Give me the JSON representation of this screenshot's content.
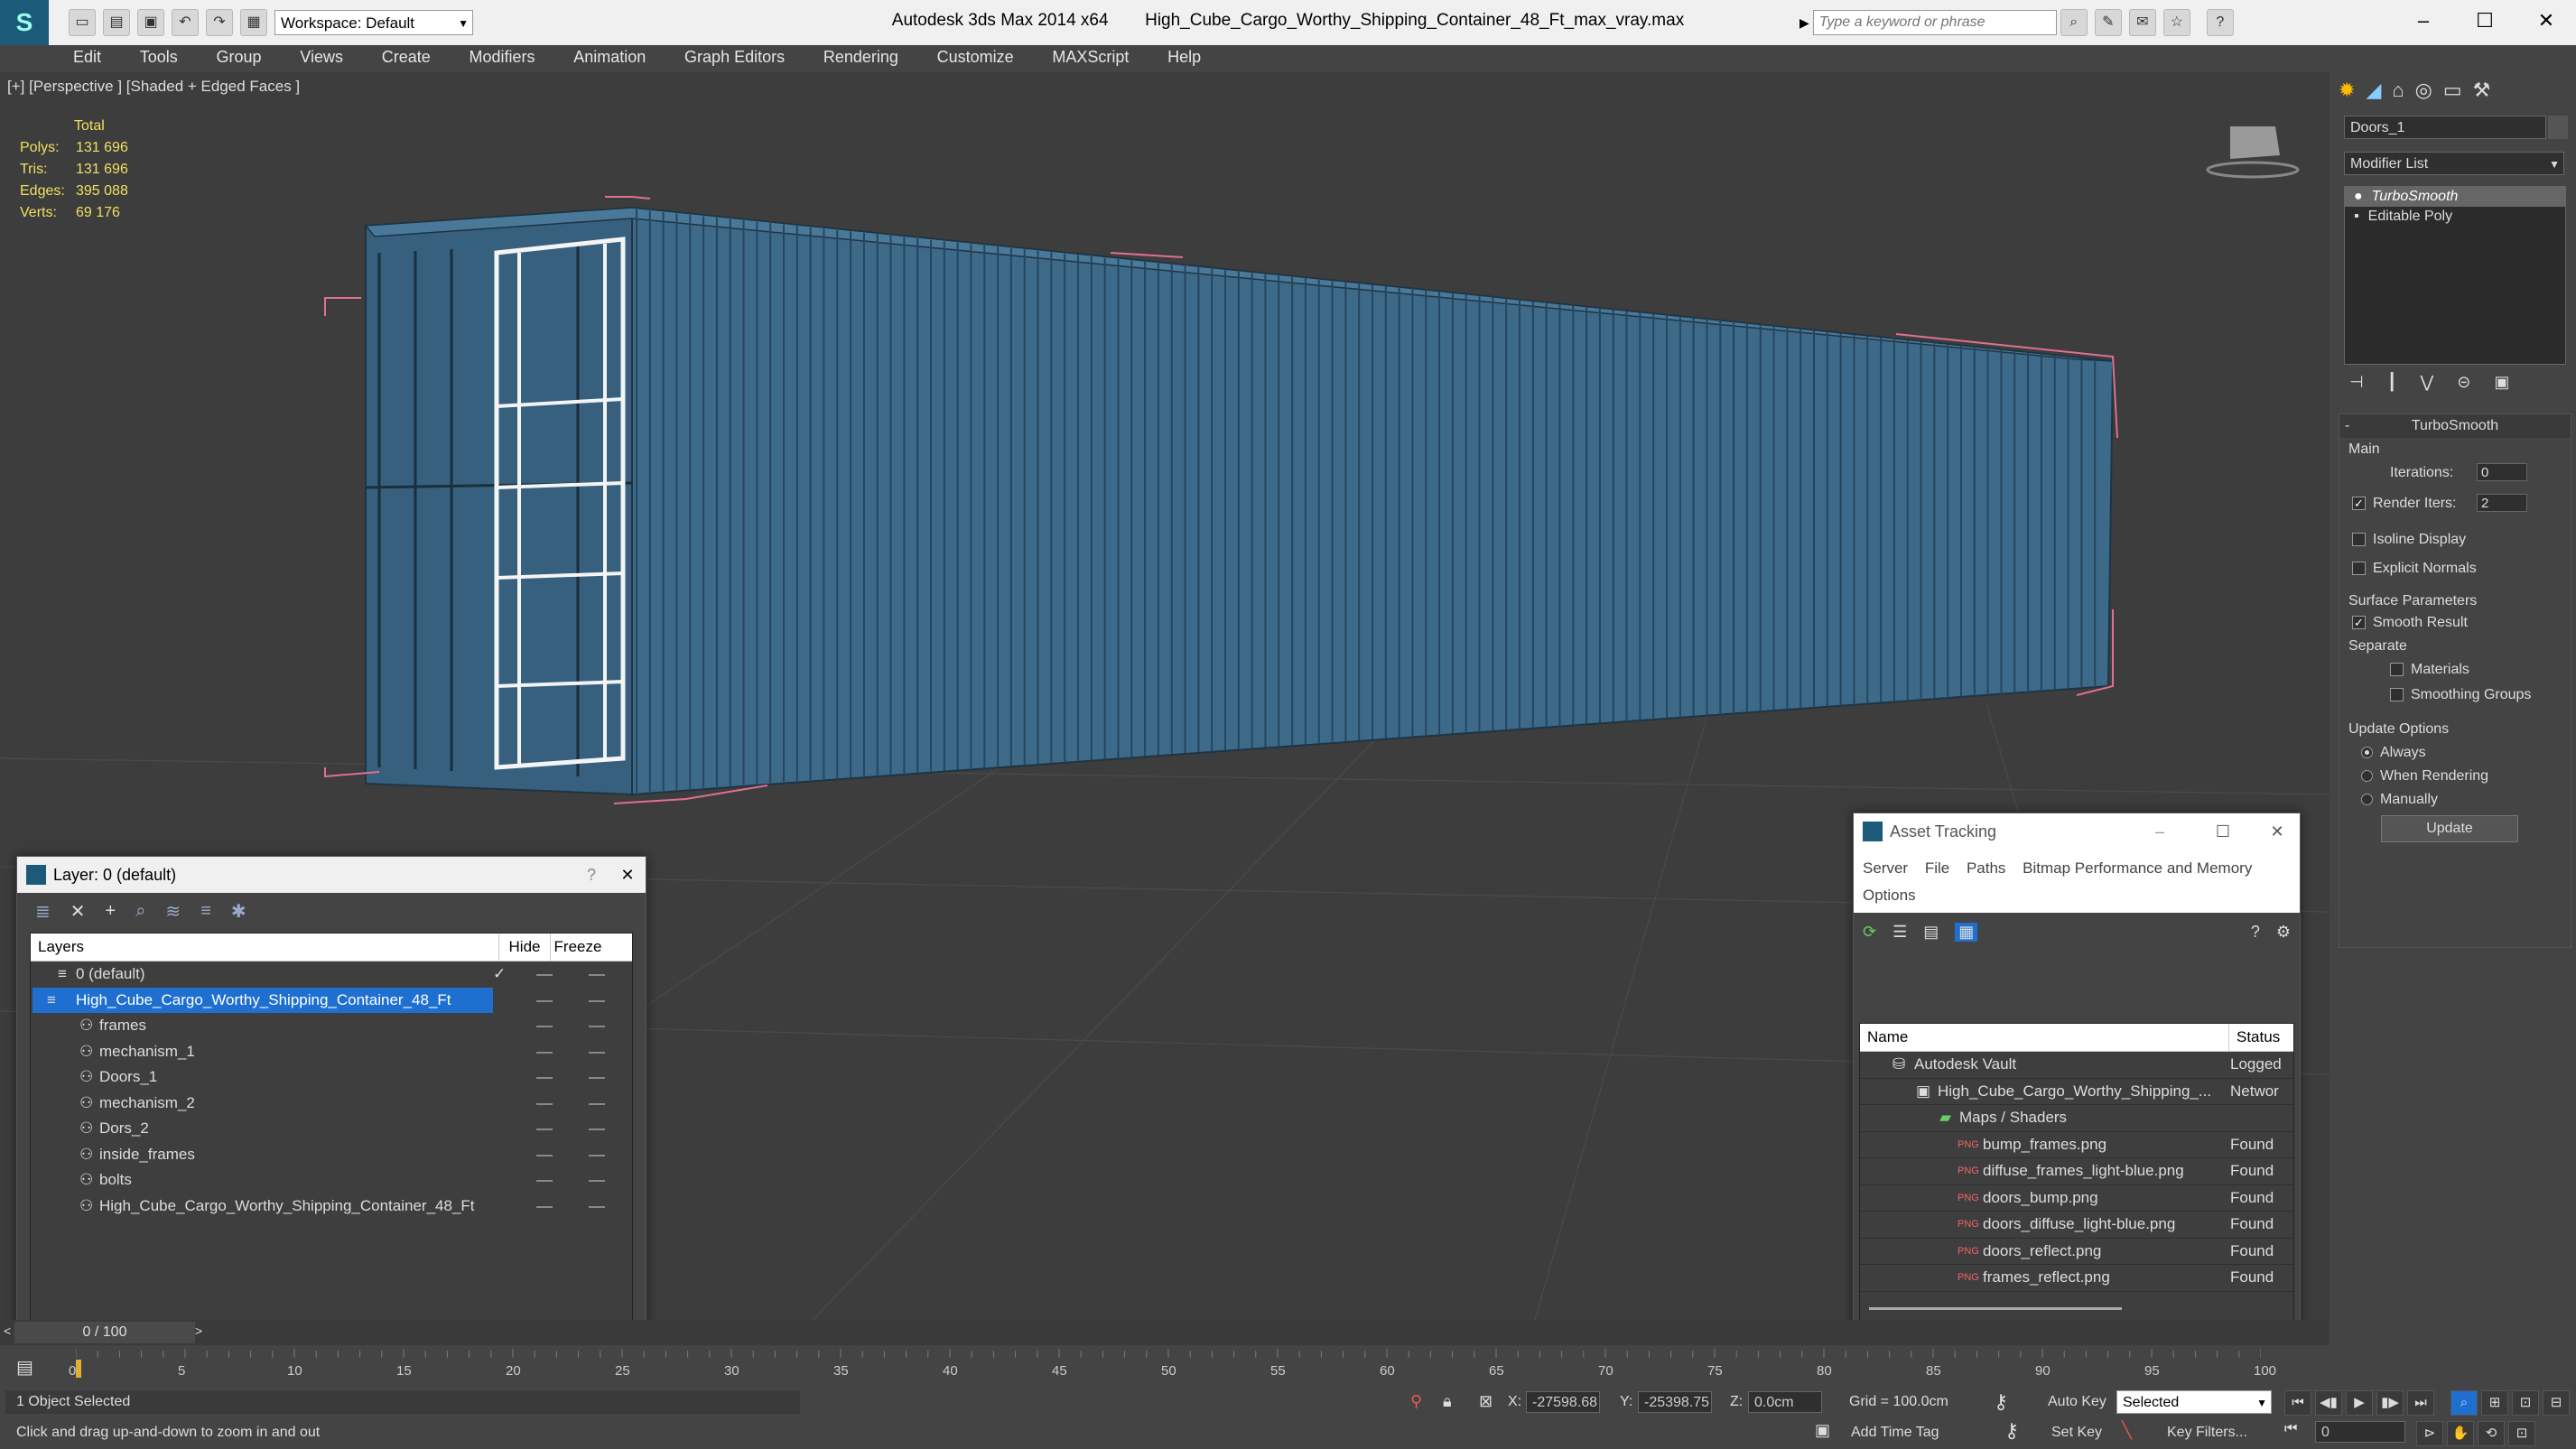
{
  "titlebar": {
    "app": "Autodesk 3ds Max  2014 x64",
    "file": "High_Cube_Cargo_Worthy_Shipping_Container_48_Ft_max_vray.max",
    "workspace": "Workspace: Default",
    "search_placeholder": "Type a keyword or phrase"
  },
  "menu": [
    "Edit",
    "Tools",
    "Group",
    "Views",
    "Create",
    "Modifiers",
    "Animation",
    "Graph Editors",
    "Rendering",
    "Customize",
    "MAXScript",
    "Help"
  ],
  "viewport": {
    "label": "[+] [Perspective ] [Shaded + Edged Faces ]",
    "stats": {
      "header": "Total",
      "rows": [
        {
          "label": "Polys:",
          "value": "131 696"
        },
        {
          "label": "Tris:",
          "value": "131 696"
        },
        {
          "label": "Edges:",
          "value": "395 088"
        },
        {
          "label": "Verts:",
          "value": "69 176"
        }
      ]
    }
  },
  "command_panel": {
    "object_name": "Doors_1",
    "modifier_list": "Modifier List",
    "stack": [
      "TurboSmooth",
      "Editable Poly"
    ],
    "rollout_title": "TurboSmooth",
    "main_label": "Main",
    "iterations_label": "Iterations:",
    "iterations_value": "0",
    "render_iters_label": "Render Iters:",
    "render_iters_value": "2",
    "isoline": "Isoline Display",
    "explicit_normals": "Explicit Normals",
    "surface_params": "Surface Parameters",
    "smooth_result": "Smooth Result",
    "separate": "Separate",
    "materials": "Materials",
    "smoothing_groups": "Smoothing Groups",
    "update_options": "Update Options",
    "always": "Always",
    "when_rendering": "When Rendering",
    "manually": "Manually",
    "update_btn": "Update"
  },
  "layer_panel": {
    "title": "Layer: 0 (default)",
    "help": "?",
    "col_layers": "Layers",
    "col_hide": "Hide",
    "col_freeze": "Freeze",
    "rows": [
      {
        "name": "0 (default)"
      },
      {
        "name": "High_Cube_Cargo_Worthy_Shipping_Container_48_Ft"
      },
      {
        "name": "frames"
      },
      {
        "name": "mechanism_1"
      },
      {
        "name": "Doors_1"
      },
      {
        "name": "mechanism_2"
      },
      {
        "name": "Dors_2"
      },
      {
        "name": "inside_frames"
      },
      {
        "name": "bolts"
      },
      {
        "name": "High_Cube_Cargo_Worthy_Shipping_Container_48_Ft"
      }
    ]
  },
  "asset_tracking": {
    "title": "Asset Tracking",
    "menu": [
      "Server",
      "File",
      "Paths",
      "Bitmap Performance and Memory",
      "Options"
    ],
    "col_name": "Name",
    "col_status": "Status",
    "rows": [
      {
        "name": "Autodesk Vault",
        "status": "Logged"
      },
      {
        "name": "High_Cube_Cargo_Worthy_Shipping_...",
        "status": "Networ"
      },
      {
        "name": "Maps / Shaders",
        "status": ""
      },
      {
        "name": "bump_frames.png",
        "status": "Found"
      },
      {
        "name": "diffuse_frames_light-blue.png",
        "status": "Found"
      },
      {
        "name": "doors_bump.png",
        "status": "Found"
      },
      {
        "name": "doors_diffuse_light-blue.png",
        "status": "Found"
      },
      {
        "name": "doors_reflect.png",
        "status": "Found"
      },
      {
        "name": "frames_reflect.png",
        "status": "Found"
      }
    ]
  },
  "timeline": {
    "frame": "0 / 100",
    "ticks": [
      "0",
      "5",
      "10",
      "15",
      "20",
      "25",
      "30",
      "35",
      "40",
      "45",
      "50",
      "55",
      "60",
      "65",
      "70",
      "75",
      "80",
      "85",
      "90",
      "95",
      "100"
    ]
  },
  "status": {
    "selected": "1 Object Selected",
    "hint": "Click and drag up-and-down to zoom in and out",
    "x_label": "X:",
    "x_value": "-27598.68",
    "y_label": "Y:",
    "y_value": "-25398.75",
    "z_label": "Z:",
    "z_value": "0.0cm",
    "grid": "Grid = 100.0cm",
    "auto_key": "Auto Key",
    "set_key": "Set Key",
    "selected_dropdown": "Selected",
    "key_filters": "Key Filters...",
    "add_time_tag": "Add Time Tag",
    "frame_field": "0"
  },
  "colors": {
    "container": "#3e6a8a",
    "selection": "#e07090",
    "highlight": "#1e6fd0"
  }
}
